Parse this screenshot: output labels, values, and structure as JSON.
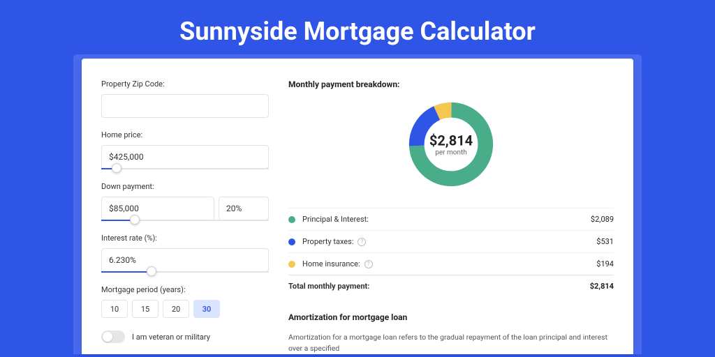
{
  "title": "Sunnyside Mortgage Calculator",
  "form": {
    "zip_label": "Property Zip Code:",
    "zip_value": "",
    "home_price_label": "Home price:",
    "home_price_value": "$425,000",
    "home_price_slider_pct": 9,
    "down_payment_label": "Down payment:",
    "down_payment_value": "$85,000",
    "down_payment_pct_value": "20%",
    "down_payment_slider_pct": 20,
    "interest_label": "Interest rate (%):",
    "interest_value": "6.230%",
    "interest_slider_pct": 30,
    "period_label": "Mortgage period (years):",
    "periods": [
      "10",
      "15",
      "20",
      "30"
    ],
    "period_selected": 3,
    "veteran_label": "I am veteran or military"
  },
  "breakdown": {
    "title": "Monthly payment breakdown:",
    "center_amount": "$2,814",
    "center_sub": "per month",
    "items": [
      {
        "label": "Principal & Interest:",
        "value": "$2,089",
        "color": "#4aad8a",
        "info": false
      },
      {
        "label": "Property taxes:",
        "value": "$531",
        "color": "#2f55e6",
        "info": true
      },
      {
        "label": "Home insurance:",
        "value": "$194",
        "color": "#f4c850",
        "info": true
      }
    ],
    "total_label": "Total monthly payment:",
    "total_value": "$2,814"
  },
  "amort": {
    "title": "Amortization for mortgage loan",
    "body": "Amortization for a mortgage loan refers to the gradual repayment of the loan principal and interest over a specified"
  },
  "chart_data": {
    "type": "pie",
    "title": "Monthly payment breakdown",
    "total": 2814,
    "series": [
      {
        "name": "Principal & Interest",
        "value": 2089,
        "color": "#4aad8a"
      },
      {
        "name": "Property taxes",
        "value": 531,
        "color": "#2f55e6"
      },
      {
        "name": "Home insurance",
        "value": 194,
        "color": "#f4c850"
      }
    ]
  }
}
